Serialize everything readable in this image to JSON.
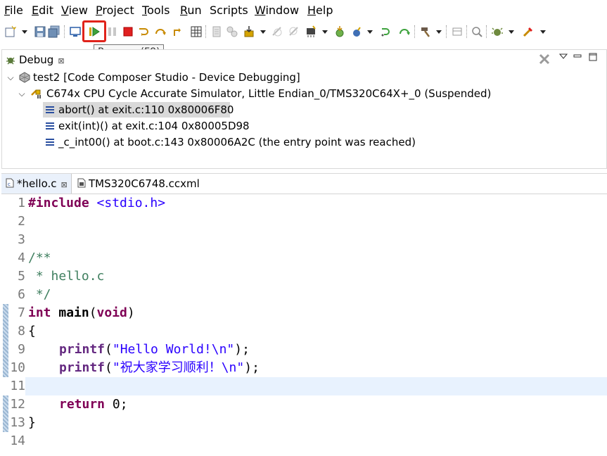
{
  "menubar": {
    "items": [
      {
        "label": "File",
        "underline": "F",
        "rest": "ile"
      },
      {
        "label": "Edit",
        "underline": "E",
        "rest": "dit"
      },
      {
        "label": "View",
        "underline": "V",
        "rest": "iew"
      },
      {
        "label": "Project",
        "underline": "P",
        "rest": "roject"
      },
      {
        "label": "Tools",
        "underline": "T",
        "rest": "ools"
      },
      {
        "label": "Run",
        "underline": "R",
        "rest": "un"
      },
      {
        "label": "Scripts",
        "underline": "",
        "rest": "Scripts"
      },
      {
        "label": "Window",
        "underline": "W",
        "rest": "indow"
      },
      {
        "label": "Help",
        "underline": "H",
        "rest": "elp"
      }
    ]
  },
  "toolbar": {
    "tooltip": "Resume (F8)",
    "highlight_color": "#e0231b"
  },
  "debug_view": {
    "tab_label": "Debug",
    "tab_close": "⊠",
    "session": "test2 [Code Composer Studio - Device Debugging]",
    "target": "C674x CPU Cycle Accurate Simulator, Little Endian_0/TMS320C64X+_0 (Suspended)",
    "frames": [
      "abort() at exit.c:110 0x80006F80",
      "exit(int)() at exit.c:104 0x80005D98",
      "_c_int00() at boot.c:143 0x80006A2C  (the entry point was reached)"
    ]
  },
  "editor": {
    "tabs": [
      {
        "label": "*hello.c",
        "close": "⊠",
        "active": true
      },
      {
        "label": "TMS320C6748.ccxml",
        "active": false
      }
    ],
    "line_numbers": [
      "1",
      "2",
      "3",
      "4",
      "5",
      "6",
      "7",
      "8",
      "9",
      "10",
      "11",
      "12",
      "13",
      "14"
    ],
    "lines": {
      "l1_directive": "#include",
      "l1_header": " <stdio.h>",
      "l4": "/**",
      "l5": " * hello.c",
      "l6": " */",
      "l7_kw": "int",
      "l7_fn": " main",
      "l7_open": "(",
      "l7_void": "void",
      "l7_close": ")",
      "l8": "{",
      "l9_fn": "printf",
      "l9_open": "(",
      "l9_str": "\"Hello World!\\n\"",
      "l9_end": ");",
      "l10_fn": "printf",
      "l10_open": "(",
      "l10_str": "\"祝大家学习顺利！\\n\"",
      "l10_end": ");",
      "l12_kw": "return",
      "l12_rest": " 0;",
      "l13": "}"
    }
  },
  "colors": {
    "keyword": "#7f0055",
    "string": "#2a00ff",
    "comment": "#3f7f5f",
    "current_line": "#e8f2fe",
    "selection": "#d9d9d9"
  }
}
